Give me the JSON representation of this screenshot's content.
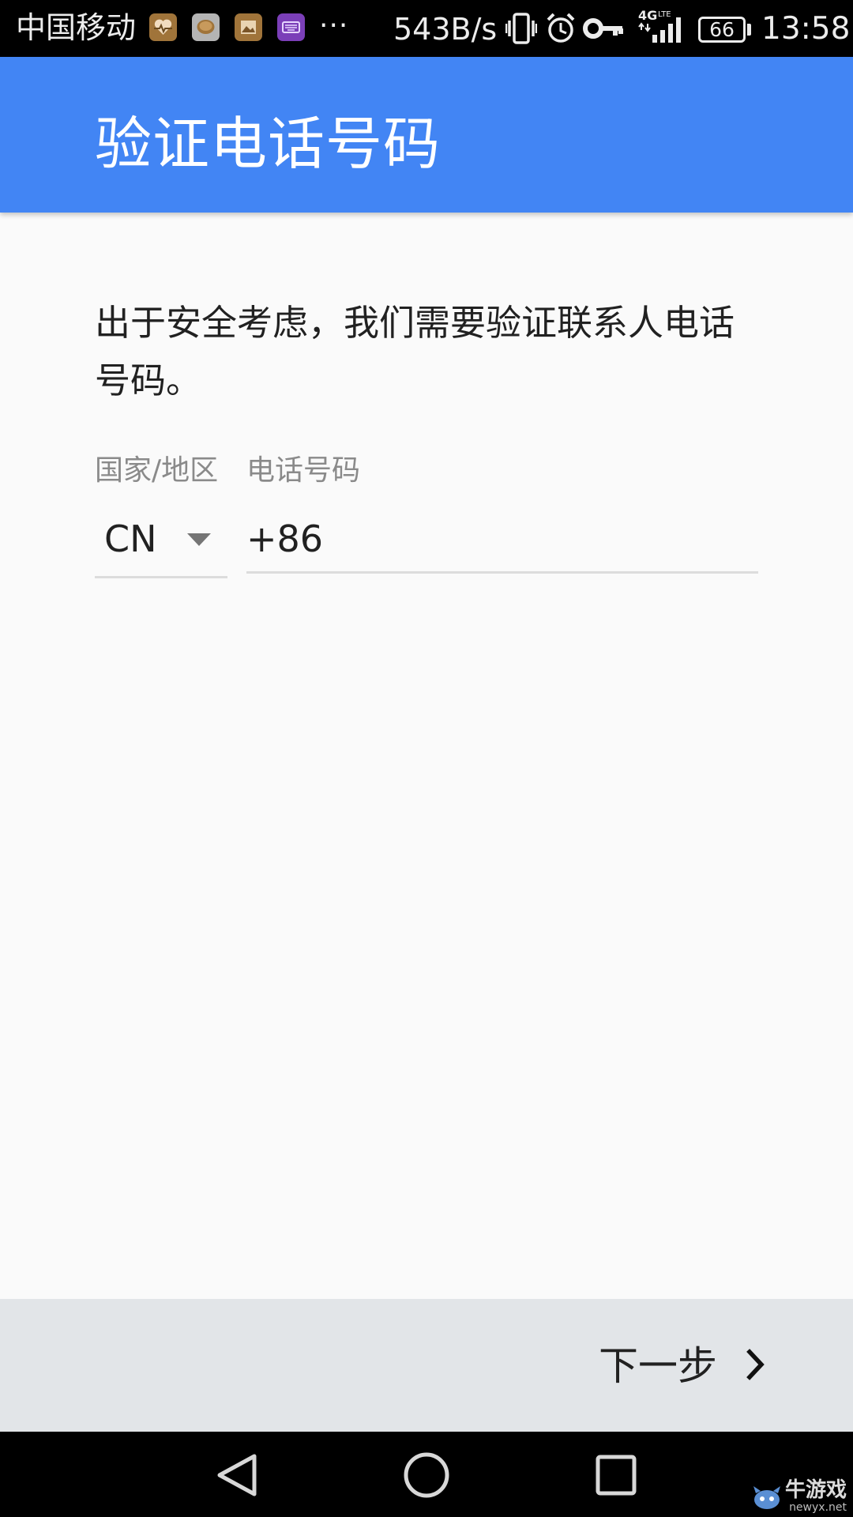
{
  "status_bar": {
    "carrier": "中国移动",
    "notification_icons": [
      "health-app-icon",
      "chat-app-icon",
      "gallery-app-icon",
      "keyboard-app-icon"
    ],
    "more": "···",
    "net_speed": "543B/s",
    "network_type": "4G LTE",
    "battery": "66",
    "time": "13:58"
  },
  "app_bar": {
    "title": "验证电话号码",
    "color": "#4285f4"
  },
  "content": {
    "message": "出于安全考虑，我们需要验证联系人电话号码。",
    "country_label": "国家/地区",
    "phone_label": "电话号码",
    "country_value": "CN",
    "phone_value": "+86"
  },
  "footer": {
    "next_label": "下一步"
  },
  "navigation_bar": {
    "buttons": [
      "back-icon",
      "home-icon",
      "recents-icon"
    ]
  },
  "watermark": {
    "name": "牛游戏",
    "url": "newyx.net"
  }
}
